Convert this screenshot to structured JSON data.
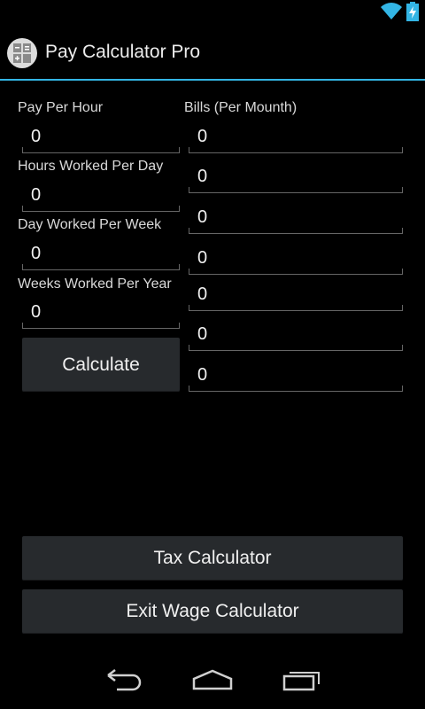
{
  "status_bar": {
    "icons": [
      "wifi-icon",
      "battery-charging-icon"
    ]
  },
  "app": {
    "title": "Pay Calculator Pro",
    "icon": "calculator-icon",
    "accent": "#33b5e5"
  },
  "left_fields": [
    {
      "label": "Pay Per Hour",
      "value": "0"
    },
    {
      "label": "Hours Worked Per Day",
      "value": "0"
    },
    {
      "label": "Day Worked Per Week",
      "value": "0"
    },
    {
      "label": "Weeks Worked Per Year",
      "value": "0"
    }
  ],
  "bills": {
    "label": "Bills (Per Mounth)",
    "values": [
      "0",
      "0",
      "0",
      "0",
      "0",
      "0",
      "0"
    ]
  },
  "buttons": {
    "calculate": "Calculate",
    "tax_calculator": "Tax Calculator",
    "exit": "Exit Wage Calculator"
  },
  "nav_bar": {
    "icons": [
      "back-icon",
      "home-icon",
      "recent-apps-icon"
    ]
  }
}
